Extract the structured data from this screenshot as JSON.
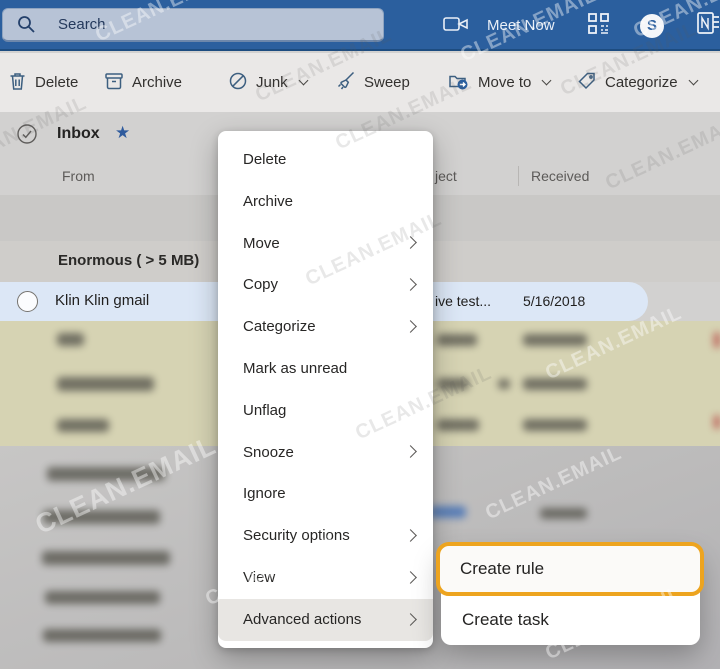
{
  "watermark": {
    "text": "CLEAN.EMAIL"
  },
  "topbar": {
    "search": {
      "placeholder": "Search"
    },
    "meet_now_label": "Meet Now"
  },
  "toolbar": {
    "delete_label": "Delete",
    "archive_label": "Archive",
    "junk_label": "Junk",
    "sweep_label": "Sweep",
    "move_to_label": "Move to",
    "categorize_label": "Categorize"
  },
  "mail_list": {
    "folder_title": "Inbox",
    "columns": {
      "from": "From",
      "subject_partial": "ject",
      "received": "Received"
    },
    "group_header": "Enormous ( > 5 MB)",
    "selected_row": {
      "from": "Klin Klin gmail",
      "subject_partial": "ive test...",
      "received": "5/16/2018"
    }
  },
  "context_menu": {
    "items": [
      {
        "label": "Delete",
        "has_submenu": false
      },
      {
        "label": "Archive",
        "has_submenu": false
      },
      {
        "label": "Move",
        "has_submenu": true
      },
      {
        "label": "Copy",
        "has_submenu": true
      },
      {
        "label": "Categorize",
        "has_submenu": true
      },
      {
        "label": "Mark as unread",
        "has_submenu": false
      },
      {
        "label": "Unflag",
        "has_submenu": false
      },
      {
        "label": "Snooze",
        "has_submenu": true
      },
      {
        "label": "Ignore",
        "has_submenu": false
      },
      {
        "label": "Security options",
        "has_submenu": true
      },
      {
        "label": "View",
        "has_submenu": true
      },
      {
        "label": "Advanced actions",
        "has_submenu": true,
        "hovered": true
      }
    ]
  },
  "submenu": {
    "create_rule_label": "Create rule",
    "create_task_label": "Create task"
  },
  "colors": {
    "topbar_blue": "#2b5f9e",
    "selected_row_bg": "#dce7f6",
    "khaki_row_bg": "#d6d3b3",
    "highlight_orange": "#eda41f",
    "star_blue": "#2f5b9d"
  }
}
